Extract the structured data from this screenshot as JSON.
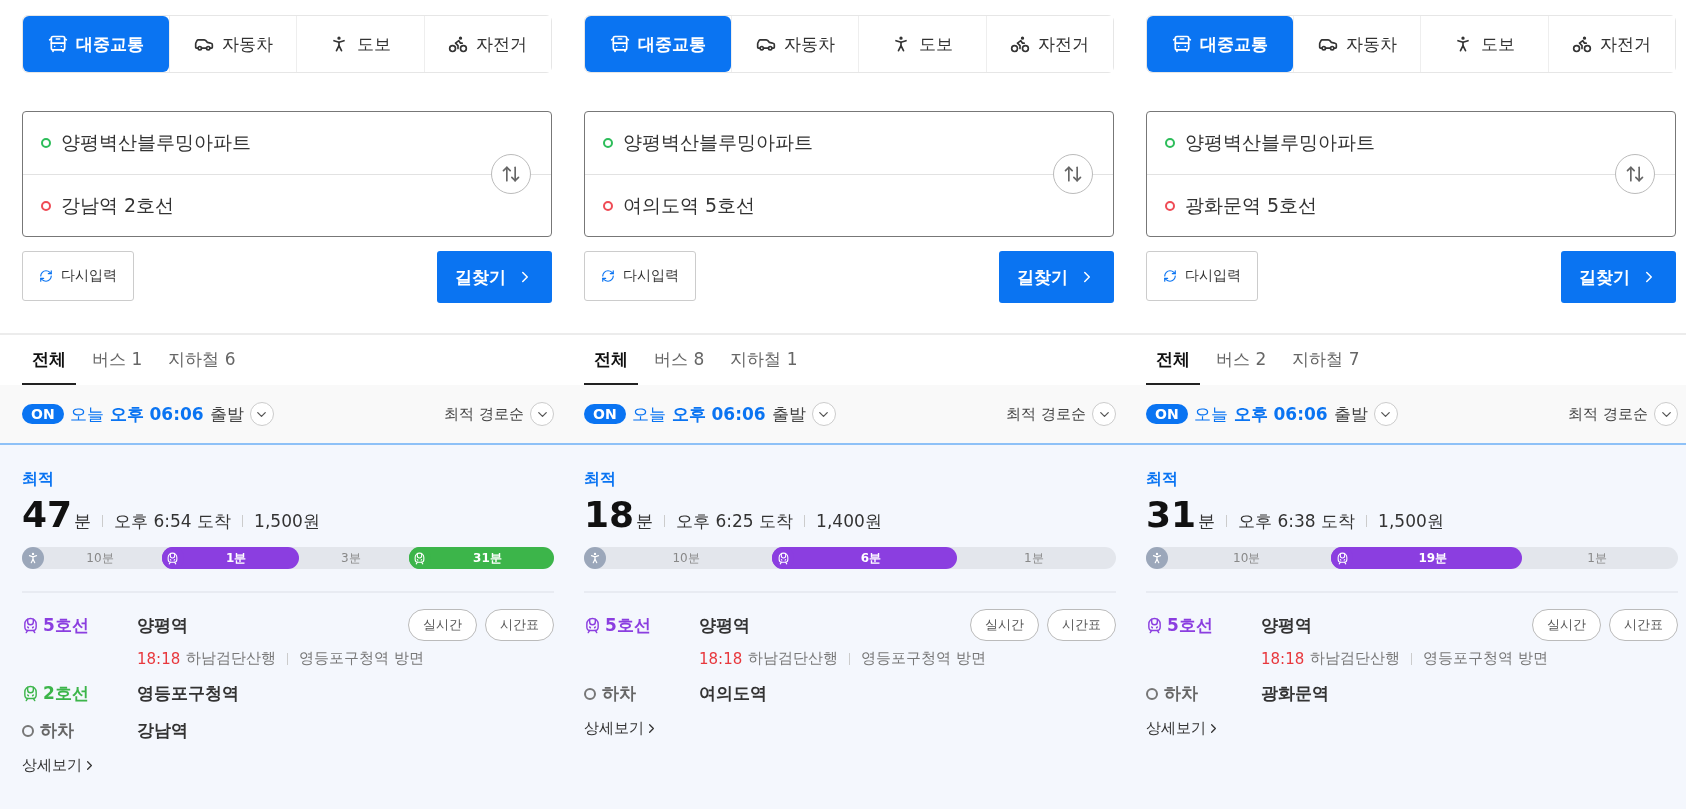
{
  "panels": [
    {
      "mode_tabs": [
        {
          "label": "대중교통",
          "kind": "bus",
          "selected": true
        },
        {
          "label": "자동차",
          "kind": "car",
          "selected": false
        },
        {
          "label": "도보",
          "kind": "walk",
          "selected": false
        },
        {
          "label": "자전거",
          "kind": "bike",
          "selected": false
        }
      ],
      "origin": "양평벽산블루밍아파트",
      "destination": "강남역 2호선",
      "reset_button": "다시입력",
      "search_button": "길찾기",
      "result_tabs": [
        {
          "label": "전체",
          "selected": true
        },
        {
          "label": "버스 1",
          "selected": false
        },
        {
          "label": "지하철 6",
          "selected": false
        }
      ],
      "departure": {
        "badge": "ON",
        "day": "오늘",
        "time": "오후 06:06",
        "suffix": "출발"
      },
      "sort": "최적 경로순",
      "route": {
        "tag": "최적",
        "duration": "47",
        "duration_unit": "분",
        "arrival": "오후 6:54 도착",
        "fare": "1,500원",
        "segments": [
          {
            "kind": "walk",
            "label": "10분"
          },
          {
            "kind": "subway",
            "label": "1분",
            "color": "#8b3ee0"
          },
          {
            "kind": "walk",
            "label": "3분"
          },
          {
            "kind": "subway",
            "label": "31분",
            "color": "#3cb54a"
          }
        ],
        "steps": [
          {
            "kind": "line",
            "line": "5호선",
            "color": "#8b3ee0",
            "station": "양평역",
            "buttons": [
              "실시간",
              "시간표"
            ],
            "time": "18:18",
            "direction": "하남검단산행",
            "toward": "영등포구청역 방면"
          },
          {
            "kind": "line",
            "line": "2호선",
            "color": "#3cb54a",
            "station": "영등포구청역"
          },
          {
            "kind": "alight",
            "line": "하차",
            "station": "강남역"
          }
        ],
        "detail_link": "상세보기"
      }
    },
    {
      "mode_tabs": [
        {
          "label": "대중교통",
          "kind": "bus",
          "selected": true
        },
        {
          "label": "자동차",
          "kind": "car",
          "selected": false
        },
        {
          "label": "도보",
          "kind": "walk",
          "selected": false
        },
        {
          "label": "자전거",
          "kind": "bike",
          "selected": false
        }
      ],
      "origin": "양평벽산블루밍아파트",
      "destination": "여의도역 5호선",
      "reset_button": "다시입력",
      "search_button": "길찾기",
      "result_tabs": [
        {
          "label": "전체",
          "selected": true
        },
        {
          "label": "버스 8",
          "selected": false
        },
        {
          "label": "지하철 1",
          "selected": false
        }
      ],
      "departure": {
        "badge": "ON",
        "day": "오늘",
        "time": "오후 06:06",
        "suffix": "출발"
      },
      "sort": "최적 경로순",
      "route": {
        "tag": "최적",
        "duration": "18",
        "duration_unit": "분",
        "arrival": "오후 6:25 도착",
        "fare": "1,400원",
        "segments": [
          {
            "kind": "walk",
            "label": "10분"
          },
          {
            "kind": "subway",
            "label": "6분",
            "color": "#8b3ee0"
          },
          {
            "kind": "walk",
            "label": "1분"
          }
        ],
        "steps": [
          {
            "kind": "line",
            "line": "5호선",
            "color": "#8b3ee0",
            "station": "양평역",
            "buttons": [
              "실시간",
              "시간표"
            ],
            "time": "18:18",
            "direction": "하남검단산행",
            "toward": "영등포구청역 방면"
          },
          {
            "kind": "alight",
            "line": "하차",
            "station": "여의도역"
          }
        ],
        "detail_link": "상세보기"
      }
    },
    {
      "mode_tabs": [
        {
          "label": "대중교통",
          "kind": "bus",
          "selected": true
        },
        {
          "label": "자동차",
          "kind": "car",
          "selected": false
        },
        {
          "label": "도보",
          "kind": "walk",
          "selected": false
        },
        {
          "label": "자전거",
          "kind": "bike",
          "selected": false
        }
      ],
      "origin": "양평벽산블루밍아파트",
      "destination": "광화문역 5호선",
      "reset_button": "다시입력",
      "search_button": "길찾기",
      "result_tabs": [
        {
          "label": "전체",
          "selected": true
        },
        {
          "label": "버스 2",
          "selected": false
        },
        {
          "label": "지하철 7",
          "selected": false
        }
      ],
      "departure": {
        "badge": "ON",
        "day": "오늘",
        "time": "오후 06:06",
        "suffix": "출발"
      },
      "sort": "최적 경로순",
      "route": {
        "tag": "최적",
        "duration": "31",
        "duration_unit": "분",
        "arrival": "오후 6:38 도착",
        "fare": "1,500원",
        "segments": [
          {
            "kind": "walk",
            "label": "10분"
          },
          {
            "kind": "subway",
            "label": "19분",
            "color": "#8b3ee0"
          },
          {
            "kind": "walk",
            "label": "1분"
          }
        ],
        "steps": [
          {
            "kind": "line",
            "line": "5호선",
            "color": "#8b3ee0",
            "station": "양평역",
            "buttons": [
              "실시간",
              "시간표"
            ],
            "time": "18:18",
            "direction": "하남검단산행",
            "toward": "영등포구청역 방면"
          },
          {
            "kind": "alight",
            "line": "하차",
            "station": "광화문역"
          }
        ],
        "detail_link": "상세보기"
      }
    }
  ]
}
